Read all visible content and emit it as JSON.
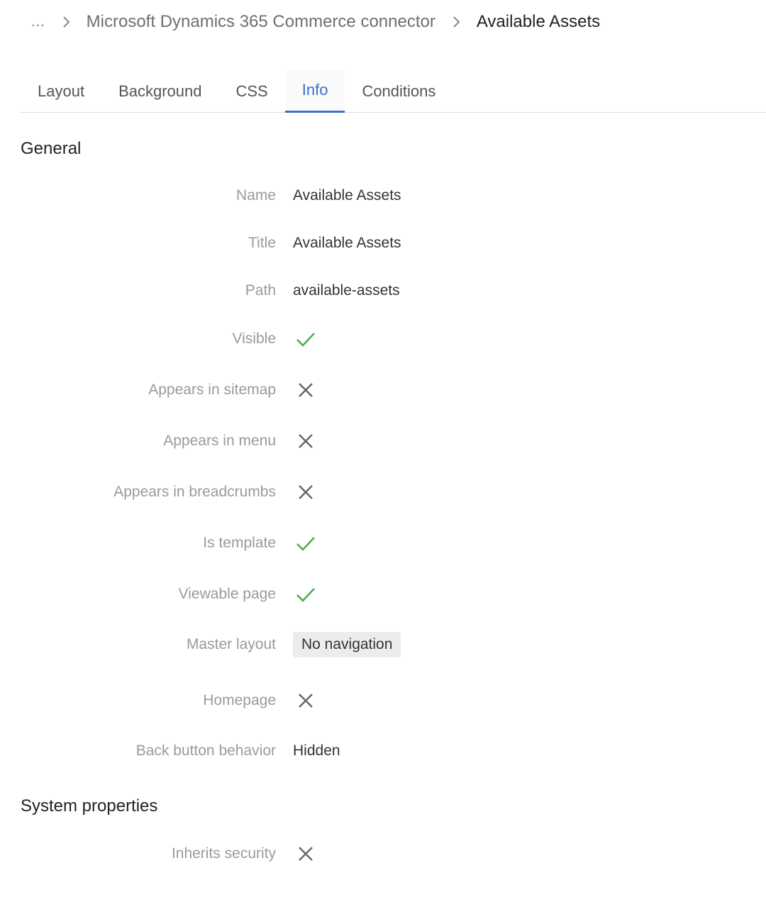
{
  "breadcrumb": {
    "ellipsis": "...",
    "parent": "Microsoft Dynamics 365 Commerce connector",
    "current": "Available Assets"
  },
  "tabs": [
    {
      "label": "Layout",
      "active": false
    },
    {
      "label": "Background",
      "active": false
    },
    {
      "label": "CSS",
      "active": false
    },
    {
      "label": "Info",
      "active": true
    },
    {
      "label": "Conditions",
      "active": false
    }
  ],
  "general": {
    "title": "General",
    "name_label": "Name",
    "name_value": "Available Assets",
    "title_label": "Title",
    "title_value": "Available Assets",
    "path_label": "Path",
    "path_value": "available-assets",
    "visible_label": "Visible",
    "visible": true,
    "sitemap_label": "Appears in sitemap",
    "sitemap": false,
    "menu_label": "Appears in menu",
    "menu": false,
    "breadcrumbs_label": "Appears in breadcrumbs",
    "breadcrumbs": false,
    "template_label": "Is template",
    "template": true,
    "viewable_label": "Viewable page",
    "viewable": true,
    "master_label": "Master layout",
    "master_value": "No navigation",
    "homepage_label": "Homepage",
    "homepage": false,
    "back_label": "Back button behavior",
    "back_value": "Hidden"
  },
  "system": {
    "title": "System properties",
    "inherits_label": "Inherits security",
    "inherits": false
  },
  "colors": {
    "accent": "#3d6fcc",
    "check": "#4caf50",
    "cross": "#666666"
  }
}
